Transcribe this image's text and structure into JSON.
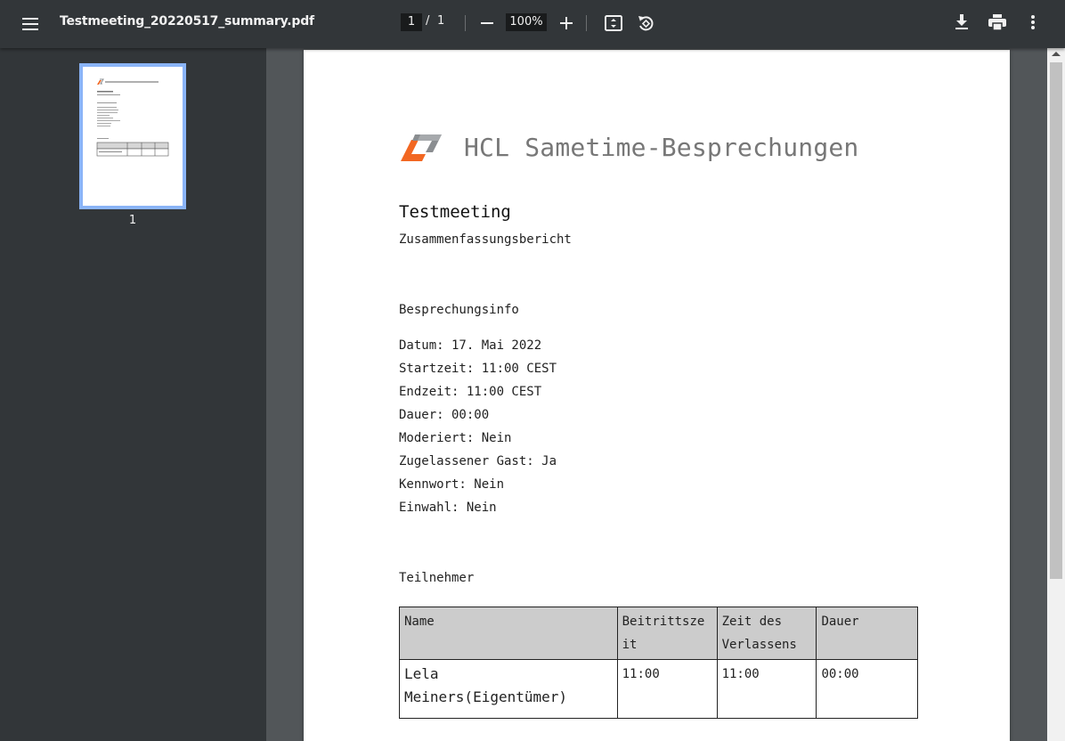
{
  "toolbar": {
    "file_name": "Testmeeting_20220517_summary.pdf",
    "current_page": "1",
    "page_separator": "/",
    "total_pages": "1",
    "zoom_level": "100%"
  },
  "sidebar": {
    "thumbnails": [
      {
        "page_label": "1"
      }
    ]
  },
  "document": {
    "brand": "HCL Sametime-Besprechungen",
    "logo_colors": {
      "orange": "#f26722",
      "gray": "#8a8d90"
    },
    "title": "Testmeeting",
    "subtitle": "Zusammenfassungsbericht",
    "info_heading": "Besprechungsinfo",
    "info_lines": [
      "Datum: 17. Mai 2022",
      "Startzeit: 11:00 CEST",
      "Endzeit: 11:00 CEST",
      "Dauer: 00:00",
      "Moderiert: Nein",
      "Zugelassener Gast: Ja",
      "Kennwort: Nein",
      "Einwahl: Nein"
    ],
    "participants_heading": "Teilnehmer",
    "table": {
      "headers": [
        "Name",
        "Beitrittszeit",
        "Zeit des Verlassens",
        "Dauer"
      ],
      "rows": [
        [
          "Lela Meiners(Eigentümer)",
          "11:00",
          "11:00",
          "00:00"
        ]
      ]
    }
  },
  "colors": {
    "toolbar_bg": "#323639",
    "viewer_bg": "#525659",
    "thumbnail_selected": "#8ab4f8",
    "table_header_bg": "#cccccc"
  }
}
